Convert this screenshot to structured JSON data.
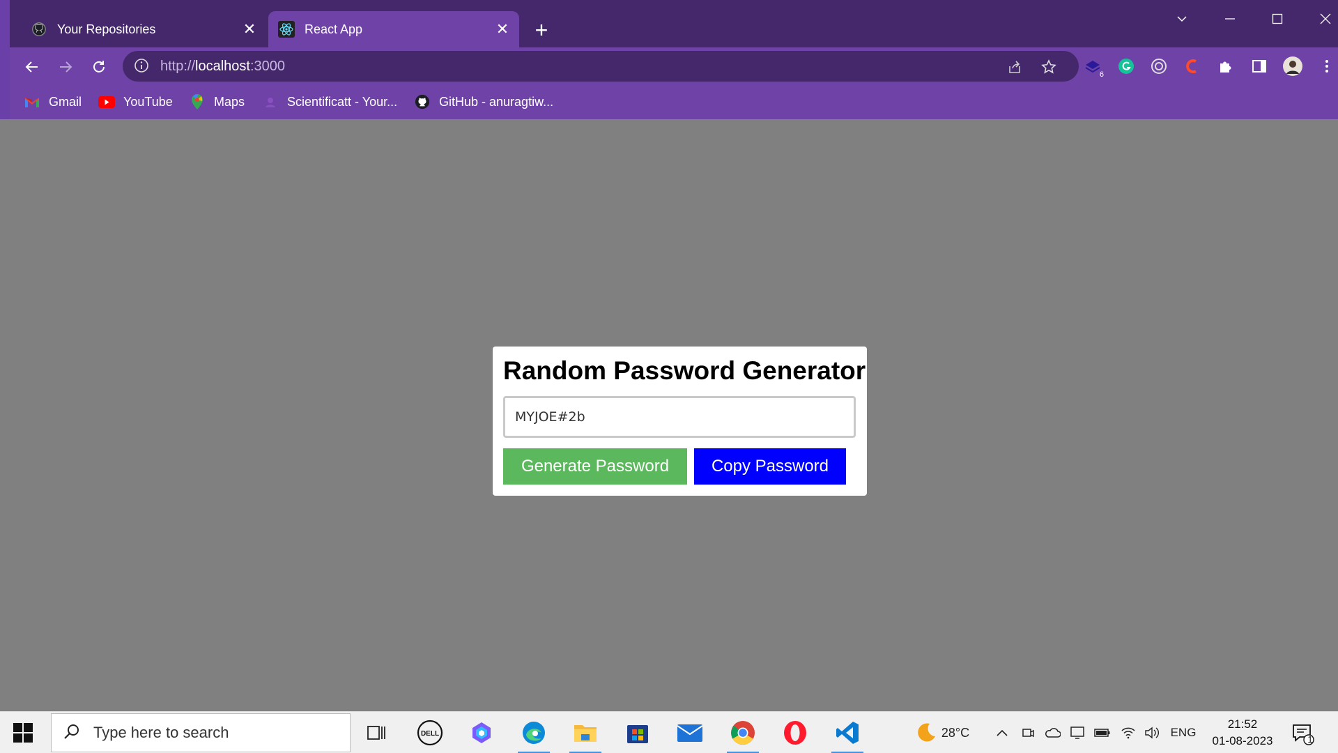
{
  "browser": {
    "tabs": [
      {
        "title": "Your Repositories",
        "favicon": "github-icon",
        "active": false
      },
      {
        "title": "React App",
        "favicon": "react-icon",
        "active": true
      }
    ],
    "address": {
      "prefix": "http://",
      "host": "localhost",
      "port": ":3000"
    },
    "extensions_badge": "6",
    "bookmarks": [
      {
        "label": "Gmail",
        "icon": "gmail-icon"
      },
      {
        "label": "YouTube",
        "icon": "youtube-icon"
      },
      {
        "label": "Maps",
        "icon": "maps-icon"
      },
      {
        "label": "Scientificatt - Your...",
        "icon": "scientificatt-icon"
      },
      {
        "label": "GitHub - anuragtiw...",
        "icon": "github-icon"
      }
    ]
  },
  "app": {
    "title": "Random Password Generator",
    "password": "MYJOE#2b",
    "generate_label": "Generate Password",
    "copy_label": "Copy Password",
    "colors": {
      "generate": "#5cb85c",
      "copy": "#0000ff",
      "page_bg": "#808080"
    }
  },
  "taskbar": {
    "search_placeholder": "Type here to search",
    "weather": "28°C",
    "language": "ENG",
    "time": "21:52",
    "date": "01-08-2023",
    "notification_count": "1"
  }
}
